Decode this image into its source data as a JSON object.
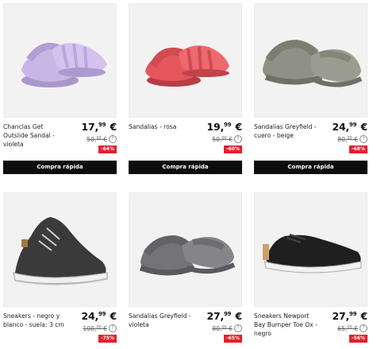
{
  "products": [
    {
      "name": "Chanclas Get Outslide Sandal - violeta",
      "price_int": "17,",
      "price_dec": "99",
      "price_cur": " €",
      "old_int": "50,",
      "old_dec": "00",
      "old_cur": " €",
      "discount": "-64%",
      "button": "Compra rápida",
      "image_icon": "purple-slide-sandal-icon",
      "color": "#c9b6e6"
    },
    {
      "name": "Sandalias - rosa",
      "price_int": "19,",
      "price_dec": "99",
      "price_cur": " €",
      "old_int": "50,",
      "old_dec": "00",
      "old_cur": " €",
      "discount": "-60%",
      "button": "Compra rápida",
      "image_icon": "pink-slide-sandal-icon",
      "color": "#e5575d"
    },
    {
      "name": "Sandalias Greyfield - cuero - beige",
      "price_int": "24,",
      "price_dec": "99",
      "price_cur": " €",
      "old_int": "80,",
      "old_dec": "00",
      "old_cur": " €",
      "discount": "-68%",
      "button": "Compra rápida",
      "image_icon": "beige-slide-sandal-icon",
      "color": "#8f9184"
    },
    {
      "name": "Sneakers - negro y blanco - suela: 3 cm",
      "price_int": "24,",
      "price_dec": "99",
      "price_cur": " €",
      "old_int": "100,",
      "old_dec": "00",
      "old_cur": " €",
      "discount": "-75%",
      "image_icon": "black-sneaker-icon",
      "color": "#3a3a3a"
    },
    {
      "name": "Sandalias Greyfield - violeta",
      "price_int": "27,",
      "price_dec": "99",
      "price_cur": " €",
      "old_int": "80,",
      "old_dec": "00",
      "old_cur": " €",
      "discount": "-65%",
      "image_icon": "grey-slide-sandal-icon",
      "color": "#747478"
    },
    {
      "name": "Sneakers Newport Bay Bumper Toe Ox - negro",
      "price_int": "27,",
      "price_dec": "99",
      "price_cur": " €",
      "old_int": "65,",
      "old_dec": "00",
      "old_cur": " €",
      "discount": "-56%",
      "image_icon": "black-canvas-sneaker-icon",
      "color": "#1f1f1f"
    }
  ],
  "colors": {
    "badge": "#e2202c",
    "button": "#0d0d0d",
    "image_bg": "#f2f2f2"
  }
}
